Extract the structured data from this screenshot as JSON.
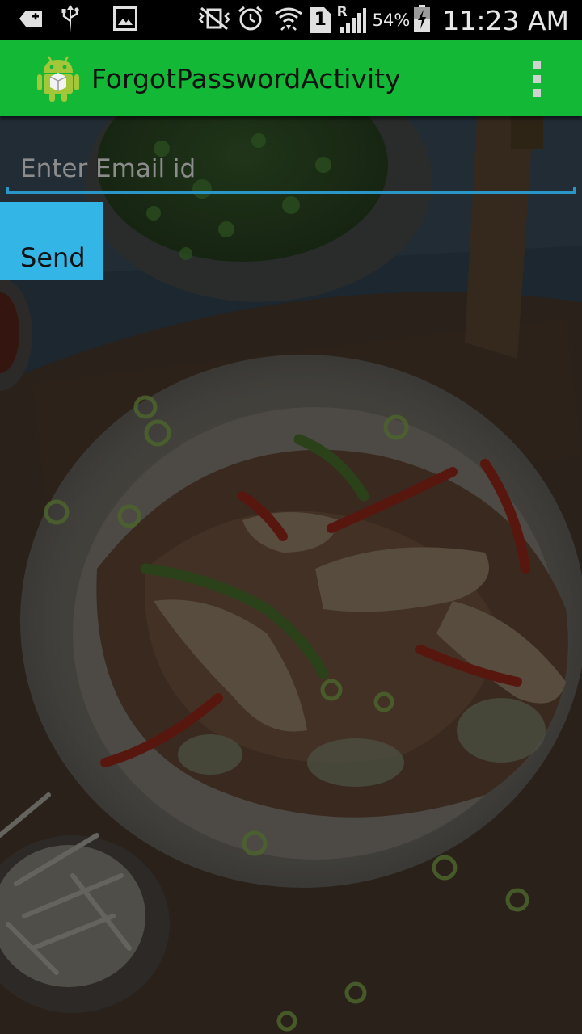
{
  "status_bar": {
    "left_icons": [
      "add-box-icon",
      "usb-icon",
      "image-icon"
    ],
    "right_icons": [
      "vibrate-icon",
      "alarm-icon",
      "wifi-icon",
      "sim-1-icon",
      "signal-roaming-icon",
      "battery-charging-icon"
    ],
    "sim_label": "1",
    "roaming_label": "R",
    "battery_percent": "54%",
    "time": "11:23 AM"
  },
  "action_bar": {
    "title": "ForgotPasswordActivity",
    "background_color": "#12b836",
    "menu_icon": "overflow-menu-icon"
  },
  "form": {
    "email_placeholder": "Enter Email id",
    "email_value": "",
    "send_label": "Send",
    "accent_color": "#2a96c8",
    "button_color": "#33b5e5"
  },
  "background": {
    "image": "food-photo"
  }
}
